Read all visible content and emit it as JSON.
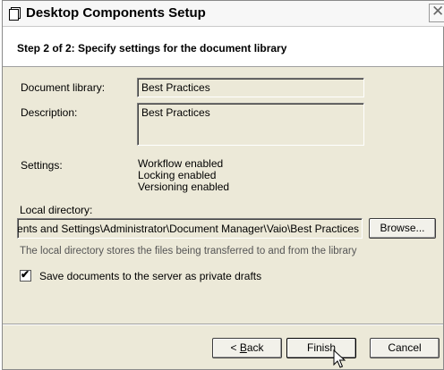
{
  "window": {
    "title": "Desktop Components Setup",
    "close_glyph": "✕"
  },
  "header": {
    "step_title": "Step 2 of 2: Specify settings for the document library"
  },
  "form": {
    "document_library_label": "Document library:",
    "document_library_value": "Best Practices",
    "description_label": "Description:",
    "description_value": "Best Practices",
    "settings_label": "Settings:",
    "settings_values": [
      "Workflow enabled",
      "Locking enabled",
      "Versioning enabled"
    ],
    "local_directory_label": "Local directory:",
    "local_directory_value": "C:\\Documents and Settings\\Administrator\\Document Manager\\Vaio\\Best Practices",
    "browse_label": "Browse...",
    "local_directory_note": "The local directory stores the files being transferred to and from the library",
    "private_drafts_label": "Save documents to the server as private drafts",
    "private_drafts_checked": true
  },
  "footer": {
    "back_prefix": "< ",
    "back_mnemonic": "B",
    "back_rest": "ack",
    "finish_label": "Finish",
    "cancel_label": "Cancel"
  },
  "icons": {
    "title": "document-icon",
    "checkbox": "checkmark-icon",
    "cursor": "arrow-cursor-icon"
  }
}
